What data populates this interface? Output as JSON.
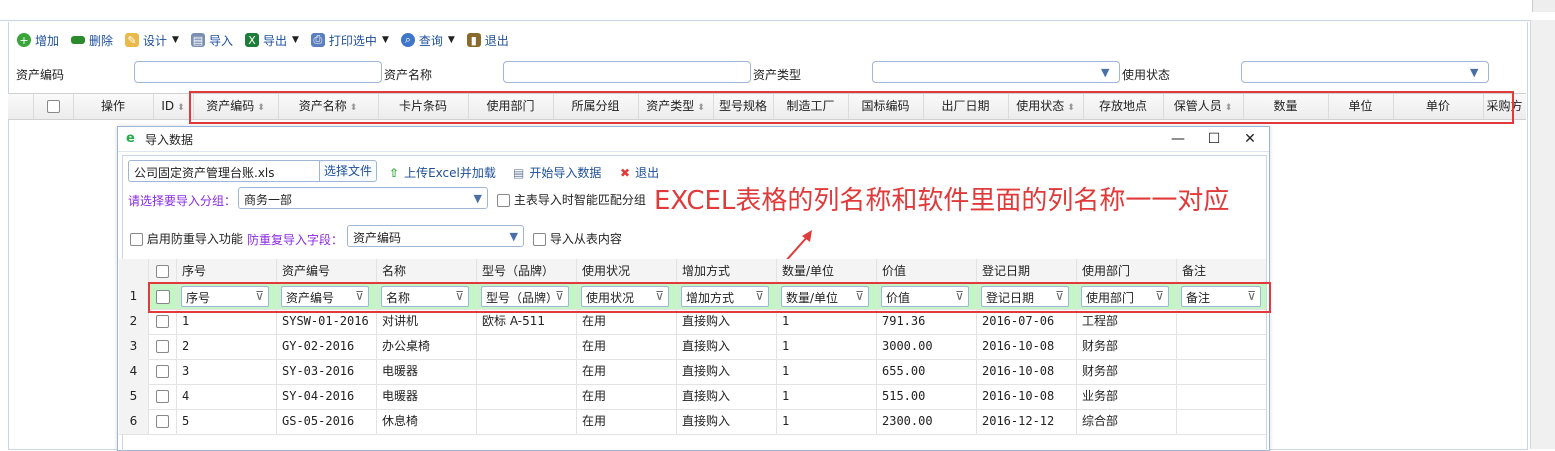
{
  "toolbar": {
    "add": "增加",
    "delete": "删除",
    "design": "设计",
    "import": "导入",
    "export": "导出",
    "print": "打印选中",
    "query": "查询",
    "exit": "退出"
  },
  "query": {
    "asset_code": "资产编码",
    "asset_name": "资产名称",
    "asset_type": "资产类型",
    "use_status": "使用状态"
  },
  "grid_columns": [
    "操作",
    "ID",
    "资产编码",
    "资产名称",
    "卡片条码",
    "使用部门",
    "所属分组",
    "资产类型",
    "型号规格",
    "制造工厂",
    "国标编码",
    "出厂日期",
    "使用状态",
    "存放地点",
    "保管人员",
    "数量",
    "单位",
    "单价",
    "采购方"
  ],
  "dialog": {
    "title": "导入数据",
    "file_name": "公司固定资产管理台账.xls",
    "choose_file": "选择文件",
    "upload": "上传Excel并加载",
    "start_import": "开始导入数据",
    "exit": "退出",
    "group_label": "请选择要导入分组：",
    "group_value": "商务一部",
    "smart_match": "主表导入时智能匹配分组",
    "dedupe_label": "启用防重导入功能",
    "dedupe_field_label": "防重复导入字段：",
    "dedupe_field_value": "资产编码",
    "import_sub": "导入从表内容"
  },
  "annotation": "EXCEL表格的列名称和软件里面的列名称一一对应",
  "import_grid": {
    "headers": [
      "序号",
      "资产编号",
      "名称",
      "型号（品牌）",
      "使用状况",
      "增加方式",
      "数量/单位",
      "价值",
      "登记日期",
      "使用部门",
      "备注"
    ],
    "mapping": [
      "序号",
      "资产编号",
      "名称",
      "型号（品牌）",
      "使用状况",
      "增加方式",
      "数量/单位",
      "价值",
      "登记日期",
      "使用部门",
      "备注"
    ],
    "row_numbers": [
      "1",
      "2",
      "3",
      "4",
      "5",
      "6"
    ],
    "rows": [
      [
        "1",
        "SYSW-01-2016",
        "对讲机",
        "欧标 A-511",
        "在用",
        "直接购入",
        "1",
        "791.36",
        "2016-07-06",
        "工程部",
        ""
      ],
      [
        "2",
        "GY-02-2016",
        "办公桌椅",
        "",
        "在用",
        "直接购入",
        "1",
        "3000.00",
        "2016-10-08",
        "财务部",
        ""
      ],
      [
        "3",
        "SY-03-2016",
        "电暖器",
        "",
        "在用",
        "直接购入",
        "1",
        "655.00",
        "2016-10-08",
        "财务部",
        ""
      ],
      [
        "4",
        "SY-04-2016",
        "电暖器",
        "",
        "在用",
        "直接购入",
        "1",
        "515.00",
        "2016-10-08",
        "业务部",
        ""
      ],
      [
        "5",
        "GS-05-2016",
        "休息椅",
        "",
        "在用",
        "直接购入",
        "1",
        "2300.00",
        "2016-12-12",
        "综合部",
        ""
      ]
    ]
  },
  "colors": {
    "accent": "#1e4f9c",
    "highlight": "#e03a3a",
    "map_cell": "#c4f5c4"
  }
}
